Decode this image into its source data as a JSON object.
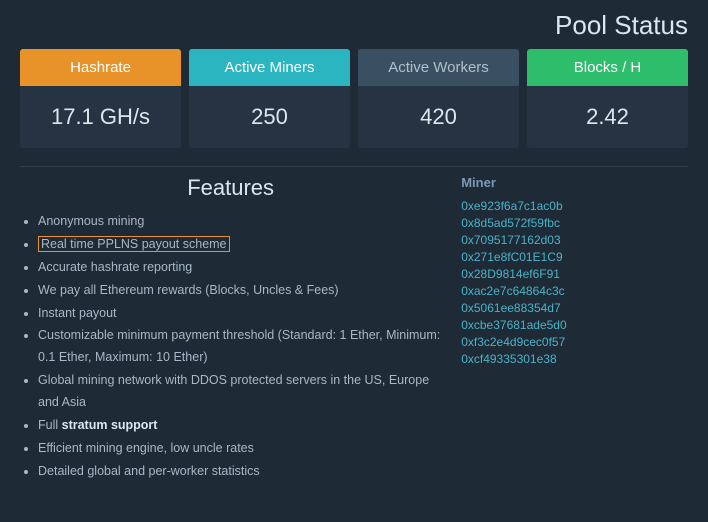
{
  "page": {
    "title": "Pool Status"
  },
  "stats": {
    "cards": [
      {
        "id": "hashrate",
        "label": "Hashrate",
        "value": "17.1 GH/s",
        "headerClass": "orange"
      },
      {
        "id": "active-miners",
        "label": "Active Miners",
        "value": "250",
        "headerClass": "teal"
      },
      {
        "id": "active-workers",
        "label": "Active Workers",
        "value": "420",
        "headerClass": "gray"
      },
      {
        "id": "blocks-h",
        "label": "Blocks / H",
        "value": "2.42",
        "headerClass": "green"
      }
    ]
  },
  "features": {
    "title": "Features",
    "items": [
      {
        "text": "Anonymous mining",
        "link": false
      },
      {
        "text": "Real time PPLNS payout scheme",
        "link": true
      },
      {
        "text": "Accurate hashrate reporting",
        "link": false
      },
      {
        "text": "We pay all Ethereum rewards (Blocks, Uncles & Fees)",
        "link": false
      },
      {
        "text": "Instant payout",
        "link": false
      },
      {
        "text": "Customizable minimum payment threshold (Standard: 1 Ether, Minimum: 0.1 Ether, Maximum: 10 Ether)",
        "link": false
      },
      {
        "text": "Global mining network with DDOS protected servers in the US, Europe and Asia",
        "link": false
      },
      {
        "text": "Full stratum support",
        "link": false,
        "bold": "stratum support"
      },
      {
        "text": "Efficient mining engine, low uncle rates",
        "link": false
      },
      {
        "text": "Detailed global and per-worker statistics",
        "link": false
      }
    ]
  },
  "miners": {
    "header": "Miner",
    "addresses": [
      "0xe923f6a7c1ac0b",
      "0x8d5ad572f59fbc",
      "0x7095177162d03",
      "0x271e8fC01E1C9",
      "0x28D9814ef6F91",
      "0xac2e7c64864c3c",
      "0x5061ee88354d7",
      "0xcbe37681ade5d0",
      "0xf3c2e4d9cec0f57",
      "0xcf49335301e38"
    ]
  }
}
